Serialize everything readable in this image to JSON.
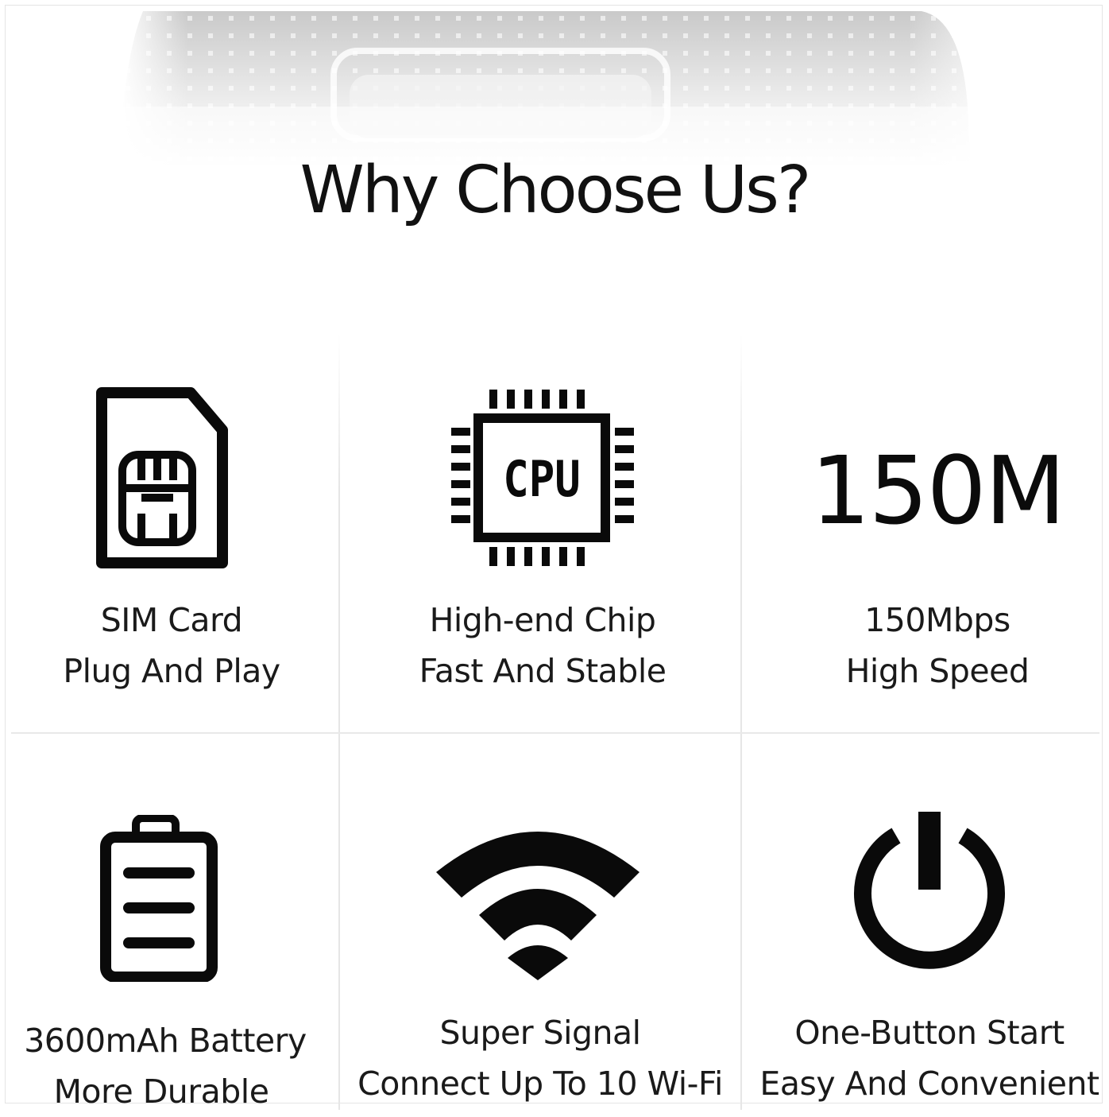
{
  "title": "Why Choose Us?",
  "features": [
    {
      "icon": "sim-card-icon",
      "line1": "SIM Card",
      "line2": "Plug And Play"
    },
    {
      "icon": "cpu-chip-icon",
      "icon_text": "CPU",
      "line1": "High-end Chip",
      "line2": "Fast And Stable"
    },
    {
      "icon": "speed-text",
      "icon_text": "150M",
      "line1": "150Mbps",
      "line2": "High Speed"
    },
    {
      "icon": "battery-icon",
      "line1": "3600mAh Battery",
      "line2": "More Durable"
    },
    {
      "icon": "wifi-icon",
      "line1": "Super Signal",
      "line2": "Connect Up To 10 Wi-Fi"
    },
    {
      "icon": "power-icon",
      "line1": "One-Button Start",
      "line2": "Easy And Convenient"
    }
  ]
}
